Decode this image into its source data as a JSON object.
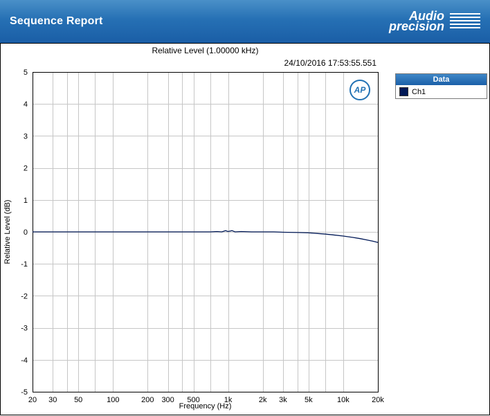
{
  "header": {
    "title": "Sequence Report",
    "logo_line1": "Audio",
    "logo_line2": "precision"
  },
  "ap_badge": {
    "text": "AP"
  },
  "legend": {
    "title": "Data",
    "items": [
      {
        "label": "Ch1",
        "color": "#001856"
      }
    ]
  },
  "colors": {
    "banner_blue": "#2670b4",
    "legend_header_blue": "#2a73b8",
    "series_navy": "#001856",
    "grid_gray": "#c6c6c6",
    "axis_black": "#000000"
  },
  "chart_data": {
    "type": "line",
    "title": "Relative Level (1.00000 kHz)",
    "timestamp": "24/10/2016 17:53:55.551",
    "xlabel": "Frequency (Hz)",
    "ylabel": "Relative Level (dB)",
    "x_scale": "log",
    "xlim": [
      20,
      20000
    ],
    "ylim": [
      -5,
      5
    ],
    "grid": true,
    "legend_position": "top-right-outside",
    "grid_color": "#c6c6c6",
    "axis_color": "#000000",
    "y_ticks": [
      5,
      4,
      3,
      2,
      1,
      0,
      -1,
      -2,
      -3,
      -4,
      -5
    ],
    "x_gridlines": [
      20,
      30,
      40,
      50,
      70,
      100,
      200,
      300,
      400,
      500,
      700,
      1000,
      2000,
      3000,
      4000,
      5000,
      7000,
      10000,
      20000
    ],
    "x_tick_labels": [
      {
        "v": 20,
        "label": "20"
      },
      {
        "v": 30,
        "label": "30"
      },
      {
        "v": 50,
        "label": "50"
      },
      {
        "v": 100,
        "label": "100"
      },
      {
        "v": 200,
        "label": "200"
      },
      {
        "v": 300,
        "label": "300"
      },
      {
        "v": 500,
        "label": "500"
      },
      {
        "v": 1000,
        "label": "1k"
      },
      {
        "v": 2000,
        "label": "2k"
      },
      {
        "v": 3000,
        "label": "3k"
      },
      {
        "v": 5000,
        "label": "5k"
      },
      {
        "v": 10000,
        "label": "10k"
      },
      {
        "v": 20000,
        "label": "20k"
      }
    ],
    "series": [
      {
        "name": "Ch1",
        "color": "#001856",
        "points": [
          [
            20,
            0.0
          ],
          [
            30,
            0.0
          ],
          [
            50,
            0.0
          ],
          [
            80,
            0.0
          ],
          [
            100,
            0.0
          ],
          [
            150,
            0.0
          ],
          [
            200,
            0.0
          ],
          [
            300,
            0.0
          ],
          [
            400,
            0.0
          ],
          [
            500,
            0.0
          ],
          [
            600,
            0.0
          ],
          [
            700,
            0.0
          ],
          [
            800,
            0.01
          ],
          [
            880,
            0.0
          ],
          [
            950,
            0.04
          ],
          [
            1000,
            0.01
          ],
          [
            1080,
            0.04
          ],
          [
            1150,
            0.0
          ],
          [
            1300,
            0.01
          ],
          [
            1600,
            0.0
          ],
          [
            2000,
            0.0
          ],
          [
            2500,
            0.0
          ],
          [
            3000,
            -0.01
          ],
          [
            4000,
            -0.02
          ],
          [
            5000,
            -0.03
          ],
          [
            6000,
            -0.05
          ],
          [
            7000,
            -0.07
          ],
          [
            8000,
            -0.09
          ],
          [
            10000,
            -0.13
          ],
          [
            12000,
            -0.17
          ],
          [
            14000,
            -0.21
          ],
          [
            16000,
            -0.25
          ],
          [
            18000,
            -0.29
          ],
          [
            20000,
            -0.33
          ]
        ]
      }
    ]
  }
}
